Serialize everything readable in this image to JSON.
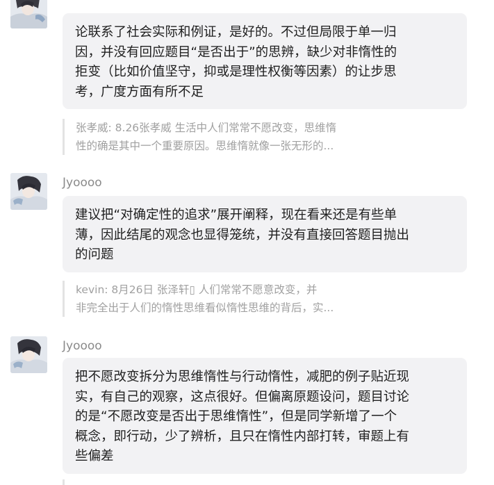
{
  "messages": [
    {
      "username": "",
      "body_lines": [
        "论联系了社会实际和例证，是好的。不过但局限于单一归",
        "因，并没有回应题目“是否出于”的思辨，缺少对非惰性的",
        "拒变（比如价值坚守，抑或是理性权衡等因素）的让步思",
        "考，广度方面有所不足"
      ],
      "quote_lines": [
        "张孝威: 8.26张孝威 生活中人们常常不愿改变，思维惰",
        "性的确是其中一个重要原因。思维惰就像一张无形的..."
      ]
    },
    {
      "username": "Jyoooo",
      "body_lines": [
        "建议把“对确定性的追求”展开阐释，现在看来还是有些单",
        "薄，因此结尾的观念也显得笼统，并没有直接回答题目抛出",
        "的问题"
      ],
      "quote_lines": [
        "kevin: 8月26日 张泽轩▯      人们常常不愿意改变，并",
        "非完全出于人们的惰性思维看似惰性思维的背后，实..."
      ]
    },
    {
      "username": "Jyoooo",
      "body_lines": [
        "把不愿改变拆分为思维惰性与行动惰性，减肥的例子贴近现",
        "实，有自己的观察，这点很好。但偏离原题设问，题目讨论",
        "的是“不愿改变是否出于思维惰性”，但是同学新增了一个",
        "概念，即行动，少了辨析，且只在惰性内部打转，审题上有",
        "些偏差"
      ],
      "quote_lines": []
    }
  ],
  "icons": {
    "avatar": "user-avatar-anime-portrait-icon"
  },
  "colors": {
    "bubble_bg": "#f2f2f4",
    "username": "#8a8a8a",
    "quote_text": "#a0a0a0",
    "quote_bar": "#e3e3e3"
  }
}
